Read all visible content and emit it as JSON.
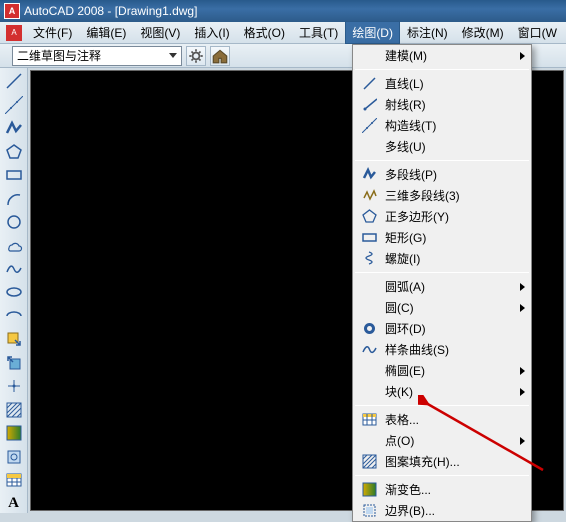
{
  "title": "AutoCAD 2008 - [Drawing1.dwg]",
  "menubar": {
    "items": [
      {
        "label": "文件(F)"
      },
      {
        "label": "编辑(E)"
      },
      {
        "label": "视图(V)"
      },
      {
        "label": "插入(I)"
      },
      {
        "label": "格式(O)"
      },
      {
        "label": "工具(T)"
      },
      {
        "label": "绘图(D)",
        "active": true
      },
      {
        "label": "标注(N)"
      },
      {
        "label": "修改(M)"
      },
      {
        "label": "窗口(W"
      }
    ]
  },
  "toolbar": {
    "combo_value": "二维草图与注释"
  },
  "dropdown": {
    "items": [
      {
        "label": "建模(M)",
        "icon": "",
        "arrow": true
      },
      {
        "sep": true
      },
      {
        "label": "直线(L)",
        "icon": "line"
      },
      {
        "label": "射线(R)",
        "icon": "ray"
      },
      {
        "label": "构造线(T)",
        "icon": "xline"
      },
      {
        "label": "多线(U)",
        "icon": ""
      },
      {
        "sep": true
      },
      {
        "label": "多段线(P)",
        "icon": "pline"
      },
      {
        "label": "三维多段线(3)",
        "icon": "3dpline"
      },
      {
        "label": "正多边形(Y)",
        "icon": "polygon"
      },
      {
        "label": "矩形(G)",
        "icon": "rect"
      },
      {
        "label": "螺旋(I)",
        "icon": "helix"
      },
      {
        "sep": true
      },
      {
        "label": "圆弧(A)",
        "icon": "",
        "arrow": true
      },
      {
        "label": "圆(C)",
        "icon": "",
        "arrow": true
      },
      {
        "label": "圆环(D)",
        "icon": "donut"
      },
      {
        "label": "样条曲线(S)",
        "icon": "spline"
      },
      {
        "label": "椭圆(E)",
        "icon": "",
        "arrow": true
      },
      {
        "label": "块(K)",
        "icon": "",
        "arrow": true
      },
      {
        "sep": true
      },
      {
        "label": "表格...",
        "icon": "table"
      },
      {
        "label": "点(O)",
        "icon": "",
        "arrow": true
      },
      {
        "label": "图案填充(H)...",
        "icon": "hatch"
      },
      {
        "sep": true
      },
      {
        "label": "渐变色...",
        "icon": "gradient"
      },
      {
        "label": "边界(B)...",
        "icon": "boundary"
      }
    ]
  }
}
